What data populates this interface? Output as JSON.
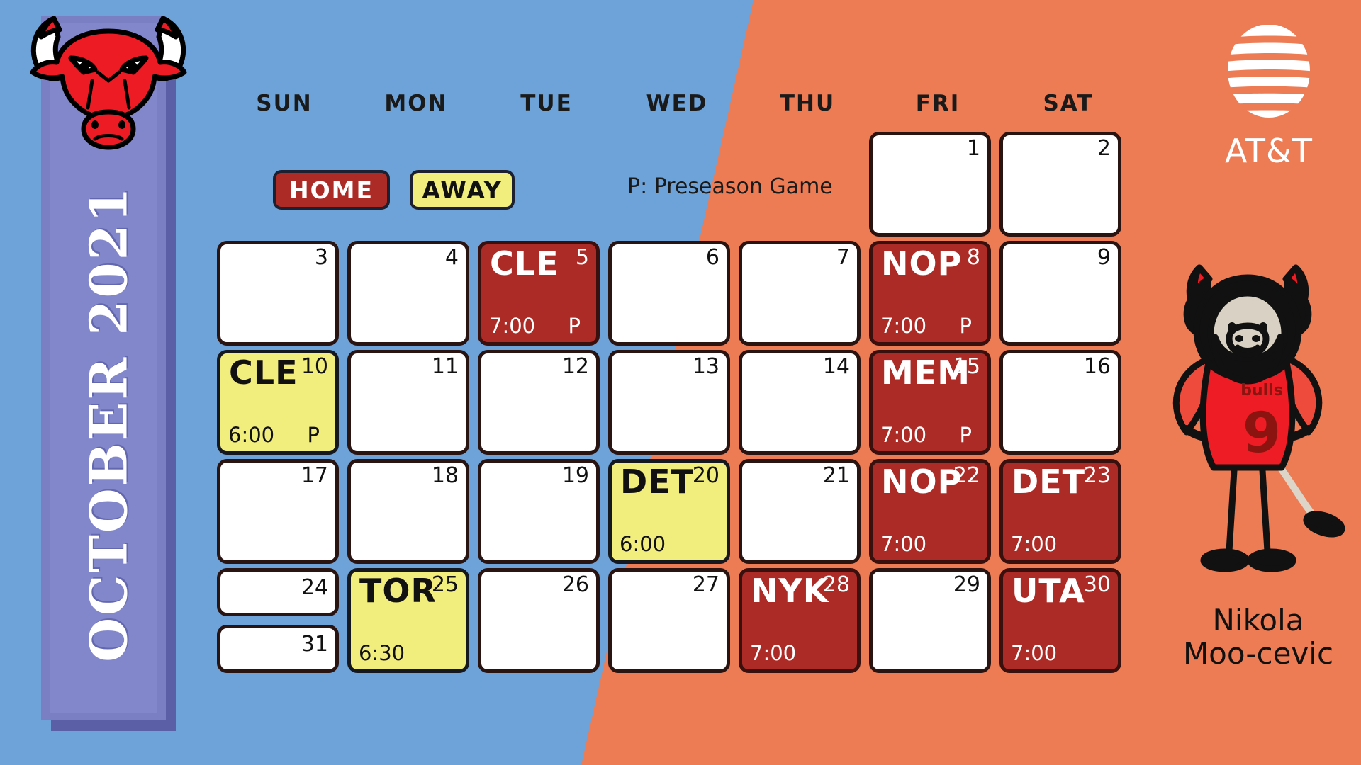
{
  "theme": {
    "bg_blue": "#6DA3D8",
    "bg_orange": "#ED7B54",
    "home_color": "#AD2B26",
    "away_color": "#F2EE7E",
    "banner_color": "#8287CC",
    "bull_red": "#ED1C24"
  },
  "banner": {
    "month_year": "OCTOBER 2021"
  },
  "header": {
    "weekdays": [
      "SUN",
      "MON",
      "TUE",
      "WED",
      "THU",
      "FRI",
      "SAT"
    ]
  },
  "legend": {
    "home_label": "HOME",
    "away_label": "AWAY",
    "note": "P:  Preseason Game"
  },
  "sponsor": {
    "name": "AT&T"
  },
  "mascot": {
    "line1": "Nikola",
    "line2": "Moo-cevic",
    "jersey_team": "bulls",
    "jersey_number": "9"
  },
  "calendar": {
    "weeks": [
      [
        {
          "day": "",
          "type": "blank"
        },
        {
          "day": "",
          "type": "blank"
        },
        {
          "day": "",
          "type": "blank"
        },
        {
          "day": "",
          "type": "blank"
        },
        {
          "day": "",
          "type": "blank"
        },
        {
          "day": "1",
          "type": "empty"
        },
        {
          "day": "2",
          "type": "empty"
        }
      ],
      [
        {
          "day": "3",
          "type": "empty"
        },
        {
          "day": "4",
          "type": "empty"
        },
        {
          "day": "5",
          "type": "home",
          "opponent": "CLE",
          "time": "7:00",
          "flag": "P"
        },
        {
          "day": "6",
          "type": "empty"
        },
        {
          "day": "7",
          "type": "empty"
        },
        {
          "day": "8",
          "type": "home",
          "opponent": "NOP",
          "time": "7:00",
          "flag": "P"
        },
        {
          "day": "9",
          "type": "empty"
        }
      ],
      [
        {
          "day": "10",
          "type": "away",
          "opponent": "CLE",
          "time": "6:00",
          "flag": "P"
        },
        {
          "day": "11",
          "type": "empty"
        },
        {
          "day": "12",
          "type": "empty"
        },
        {
          "day": "13",
          "type": "empty"
        },
        {
          "day": "14",
          "type": "empty"
        },
        {
          "day": "15",
          "type": "home",
          "opponent": "MEM",
          "time": "7:00",
          "flag": "P"
        },
        {
          "day": "16",
          "type": "empty"
        }
      ],
      [
        {
          "day": "17",
          "type": "empty"
        },
        {
          "day": "18",
          "type": "empty"
        },
        {
          "day": "19",
          "type": "empty"
        },
        {
          "day": "20",
          "type": "away",
          "opponent": "DET",
          "time": "6:00",
          "flag": ""
        },
        {
          "day": "21",
          "type": "empty"
        },
        {
          "day": "22",
          "type": "home",
          "opponent": "NOP",
          "time": "7:00",
          "flag": ""
        },
        {
          "day": "23",
          "type": "home",
          "opponent": "DET",
          "time": "7:00",
          "flag": ""
        }
      ],
      [
        {
          "day": "24",
          "type": "empty",
          "split_day": "31"
        },
        {
          "day": "25",
          "type": "away",
          "opponent": "TOR",
          "time": "6:30",
          "flag": ""
        },
        {
          "day": "26",
          "type": "empty"
        },
        {
          "day": "27",
          "type": "empty"
        },
        {
          "day": "28",
          "type": "home",
          "opponent": "NYK",
          "time": "7:00",
          "flag": ""
        },
        {
          "day": "29",
          "type": "empty"
        },
        {
          "day": "30",
          "type": "home",
          "opponent": "UTA",
          "time": "7:00",
          "flag": ""
        }
      ]
    ]
  }
}
